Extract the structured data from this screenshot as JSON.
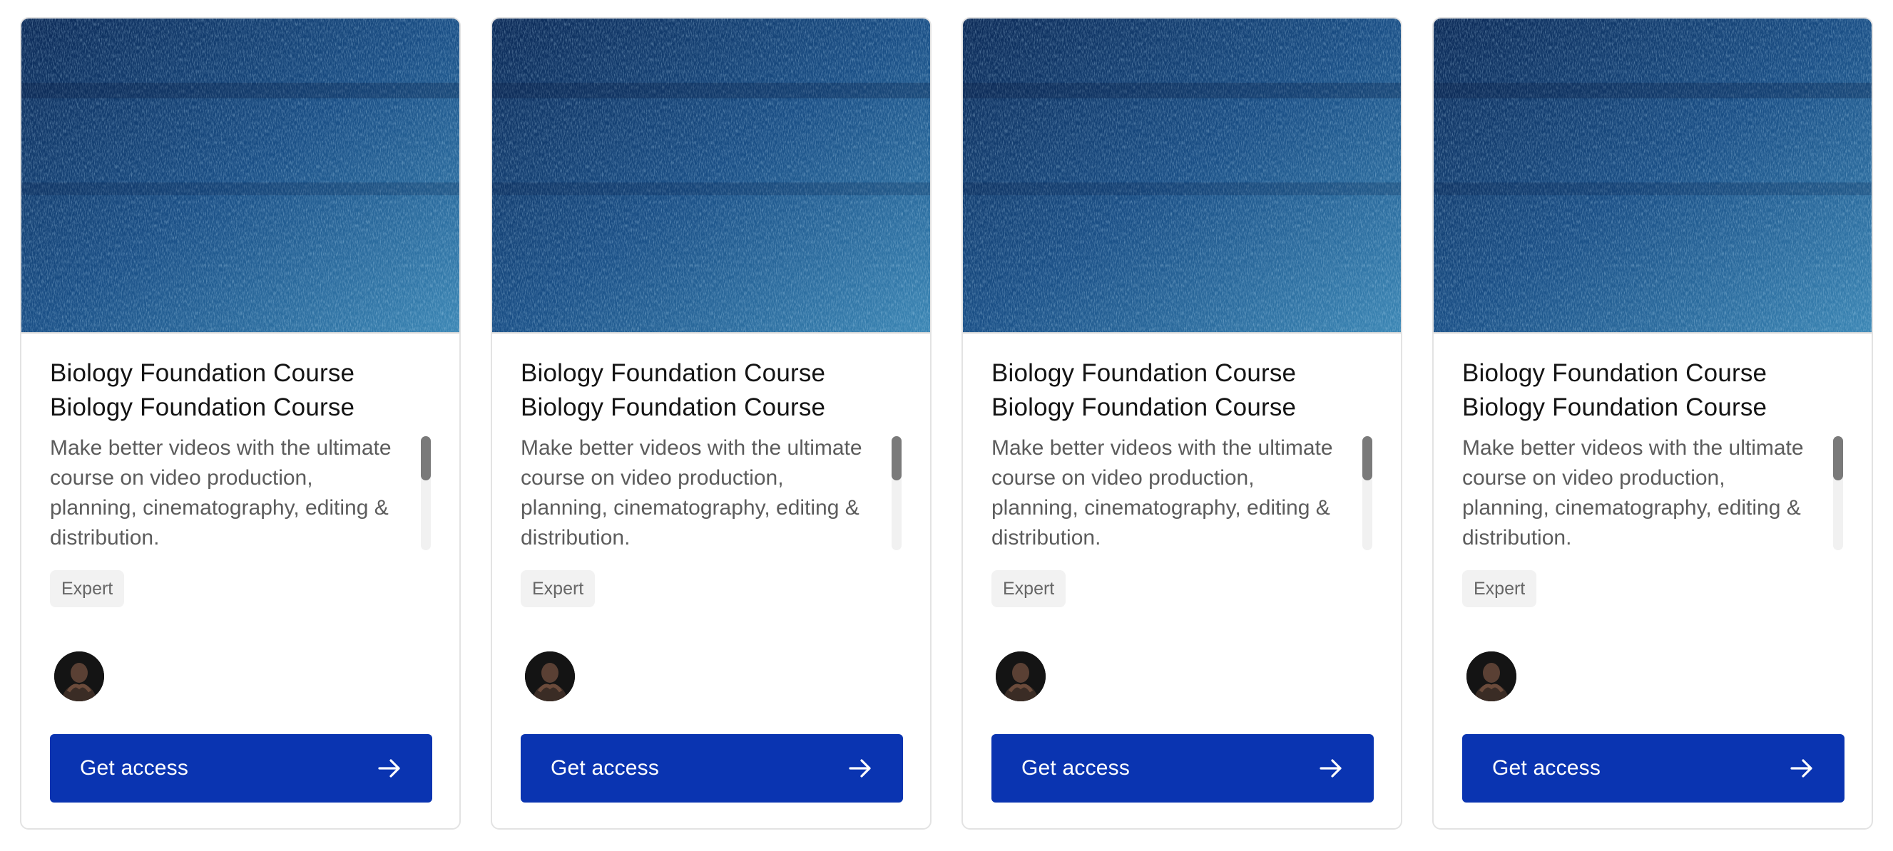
{
  "cards": [
    {
      "title_line1": "Biology Foundation Course",
      "title_line2": "Biology Foundation Course",
      "description": "Make better videos with the ultimate course on video production, planning, cinematography, editing & distribution.",
      "level": "Expert",
      "cta_label": "Get access",
      "thumbnail_icon": "blue-texture-image",
      "avatar_icon": "instructor-avatar",
      "cta_icon": "arrow-right-icon"
    },
    {
      "title_line1": "Biology Foundation Course",
      "title_line2": "Biology Foundation Course",
      "description": "Make better videos with the ultimate course on video production, planning, cinematography, editing & distribution.",
      "level": "Expert",
      "cta_label": "Get access",
      "thumbnail_icon": "blue-texture-image",
      "avatar_icon": "instructor-avatar",
      "cta_icon": "arrow-right-icon"
    },
    {
      "title_line1": "Biology Foundation Course",
      "title_line2": "Biology Foundation Course",
      "description": "Make better videos with the ultimate course on video production, planning, cinematography, editing & distribution.",
      "level": "Expert",
      "cta_label": "Get access",
      "thumbnail_icon": "blue-texture-image",
      "avatar_icon": "instructor-avatar",
      "cta_icon": "arrow-right-icon"
    },
    {
      "title_line1": "Biology Foundation Course",
      "title_line2": "Biology Foundation Course",
      "description": "Make better videos with the ultimate course on video production, planning, cinematography, editing & distribution.",
      "level": "Expert",
      "cta_label": "Get access",
      "thumbnail_icon": "blue-texture-image",
      "avatar_icon": "instructor-avatar",
      "cta_icon": "arrow-right-icon"
    }
  ],
  "colors": {
    "button_bg": "#0a34b1",
    "title_text": "#141414",
    "body_text": "#5c5c5c",
    "badge_bg": "#f2f2f2",
    "card_border": "#e3e3e3"
  }
}
